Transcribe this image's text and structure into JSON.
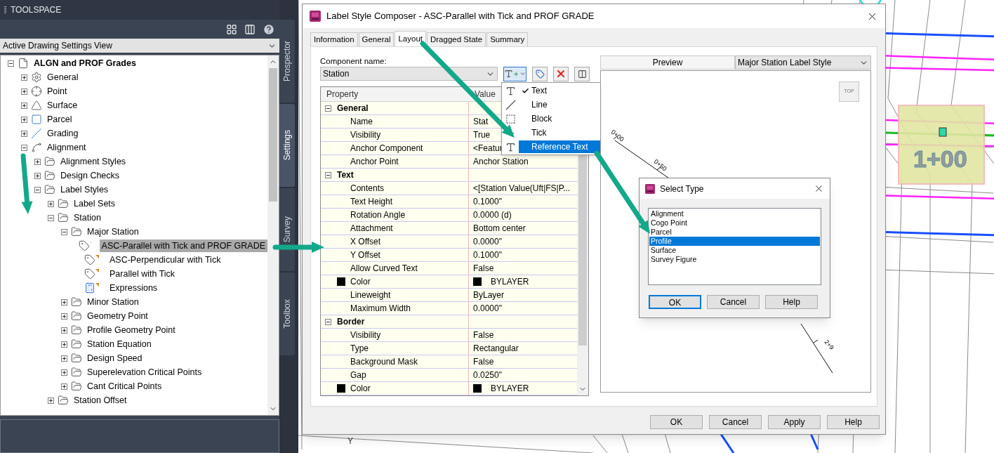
{
  "toolspace": {
    "title": "TOOLSPACE",
    "view": "Active Drawing Settings View",
    "tree": [
      {
        "label": "ALGN and PROF Grades",
        "kind": "drawing",
        "expanded": true,
        "selected": false,
        "children": [
          {
            "label": "General",
            "kind": "general",
            "expanded": false,
            "selected": false
          },
          {
            "label": "Point",
            "kind": "point",
            "expanded": false,
            "selected": false
          },
          {
            "label": "Surface",
            "kind": "surface",
            "expanded": false,
            "selected": false
          },
          {
            "label": "Parcel",
            "kind": "parcel",
            "expanded": false,
            "selected": false
          },
          {
            "label": "Grading",
            "kind": "grading",
            "expanded": false,
            "selected": false
          },
          {
            "label": "Alignment",
            "kind": "alignment",
            "expanded": true,
            "selected": false,
            "children": [
              {
                "label": "Alignment Styles",
                "kind": "folder",
                "expanded": false,
                "selected": false
              },
              {
                "label": "Design Checks",
                "kind": "folder",
                "expanded": false,
                "selected": false
              },
              {
                "label": "Label Styles",
                "kind": "folder",
                "expanded": true,
                "selected": false,
                "children": [
                  {
                    "label": "Label Sets",
                    "kind": "folder",
                    "expanded": false,
                    "selected": false
                  },
                  {
                    "label": "Station",
                    "kind": "folder",
                    "expanded": true,
                    "selected": false,
                    "children": [
                      {
                        "label": "Major Station",
                        "kind": "folder",
                        "expanded": true,
                        "selected": false,
                        "children": [
                          {
                            "label": "ASC-Parallel with Tick and PROF GRADE",
                            "kind": "style",
                            "selected": true
                          },
                          {
                            "label": "ASC-Perpendicular with Tick",
                            "kind": "style",
                            "selected": false
                          },
                          {
                            "label": "Parallel with Tick",
                            "kind": "style",
                            "selected": false
                          },
                          {
                            "label": "Expressions",
                            "kind": "expressions",
                            "selected": false
                          }
                        ]
                      },
                      {
                        "label": "Minor Station",
                        "kind": "folder",
                        "expanded": false,
                        "selected": false
                      },
                      {
                        "label": "Geometry Point",
                        "kind": "folder",
                        "expanded": false,
                        "selected": false
                      },
                      {
                        "label": "Profile Geometry Point",
                        "kind": "folder",
                        "expanded": false,
                        "selected": false
                      },
                      {
                        "label": "Station Equation",
                        "kind": "folder",
                        "expanded": false,
                        "selected": false
                      },
                      {
                        "label": "Design Speed",
                        "kind": "folder",
                        "expanded": false,
                        "selected": false
                      },
                      {
                        "label": "Superelevation Critical Points",
                        "kind": "folder",
                        "expanded": false,
                        "selected": false
                      },
                      {
                        "label": "Cant Critical Points",
                        "kind": "folder",
                        "expanded": false,
                        "selected": false
                      }
                    ]
                  },
                  {
                    "label": "Station Offset",
                    "kind": "folder",
                    "expanded": false,
                    "selected": false
                  }
                ]
              }
            ]
          }
        ]
      }
    ]
  },
  "side_tabs": [
    {
      "label": "Prospector",
      "selected": false
    },
    {
      "label": "Settings",
      "selected": true
    },
    {
      "label": "Survey",
      "selected": false
    },
    {
      "label": "Toolbox",
      "selected": false
    }
  ],
  "drawing": {
    "labels": [
      "1+00",
      "Y"
    ]
  },
  "dialog": {
    "title": "Label Style Composer - ASC-Parallel with Tick and PROF GRADE",
    "tabs": [
      {
        "label": "Information",
        "selected": false
      },
      {
        "label": "General",
        "selected": false
      },
      {
        "label": "Layout",
        "selected": true
      },
      {
        "label": "Dragged State",
        "selected": false
      },
      {
        "label": "Summary",
        "selected": false
      }
    ],
    "component_label": "Component name:",
    "component_value": "Station",
    "add_menu": [
      {
        "label": "Text",
        "kind": "text",
        "checked": true,
        "selected": false
      },
      {
        "label": "Line",
        "kind": "line",
        "checked": false,
        "selected": false
      },
      {
        "label": "Block",
        "kind": "block",
        "checked": false,
        "selected": false
      },
      {
        "label": "Tick",
        "kind": "tick",
        "checked": false,
        "selected": false
      },
      {
        "label": "Reference Text",
        "kind": "reference",
        "checked": false,
        "selected": true
      }
    ],
    "grid": {
      "columns": [
        "Property",
        "Value"
      ],
      "sections": [
        {
          "name": "General",
          "expanded": true,
          "rows": [
            {
              "property": "Name",
              "value": "Stat",
              "kind": "text"
            },
            {
              "property": "Visibility",
              "value": "True",
              "kind": "text"
            },
            {
              "property": "Anchor Component",
              "value": "<Featur",
              "kind": "text"
            },
            {
              "property": "Anchor Point",
              "value": "Anchor Station",
              "kind": "text"
            }
          ]
        },
        {
          "name": "Text",
          "expanded": true,
          "rows": [
            {
              "property": "Contents",
              "value": "<[Station Value(Uft|FS|P...",
              "kind": "text"
            },
            {
              "property": "Text Height",
              "value": "0.1000\"",
              "kind": "text"
            },
            {
              "property": "Rotation Angle",
              "value": "0.0000 (d)",
              "kind": "text"
            },
            {
              "property": "Attachment",
              "value": "Bottom center",
              "kind": "text"
            },
            {
              "property": "X Offset",
              "value": "0.0000\"",
              "kind": "text"
            },
            {
              "property": "Y Offset",
              "value": "0.1000\"",
              "kind": "text"
            },
            {
              "property": "Allow Curved Text",
              "value": "False",
              "kind": "text"
            },
            {
              "property": "Color",
              "value": "BYLAYER",
              "kind": "color",
              "color": "#000000"
            },
            {
              "property": "Lineweight",
              "value": "ByLayer",
              "kind": "text"
            },
            {
              "property": "Maximum Width",
              "value": "0.0000\"",
              "kind": "text"
            }
          ]
        },
        {
          "name": "Border",
          "expanded": true,
          "rows": [
            {
              "property": "Visibility",
              "value": "False",
              "kind": "text"
            },
            {
              "property": "Type",
              "value": "Rectangular",
              "kind": "text"
            },
            {
              "property": "Background Mask",
              "value": "False",
              "kind": "text"
            },
            {
              "property": "Gap",
              "value": "0.0250\"",
              "kind": "text"
            },
            {
              "property": "Color",
              "value": "BYLAYER",
              "kind": "color",
              "color": "#000000"
            }
          ]
        }
      ]
    },
    "preview": {
      "label": "Preview",
      "style": "Major Station Label Style",
      "view_button": "TOP",
      "labels": [
        "0+00",
        "0+50",
        "2+9"
      ]
    },
    "buttons": [
      "OK",
      "Cancel",
      "Apply",
      "Help"
    ]
  },
  "select_type": {
    "title": "Select Type",
    "items": [
      {
        "label": "Alignment",
        "selected": false
      },
      {
        "label": "Cogo Point",
        "selected": false
      },
      {
        "label": "Parcel",
        "selected": false
      },
      {
        "label": "Profile",
        "selected": true
      },
      {
        "label": "Surface",
        "selected": false
      },
      {
        "label": "Survey Figure",
        "selected": false
      }
    ],
    "buttons": [
      {
        "label": "OK",
        "default": true
      },
      {
        "label": "Cancel",
        "default": false
      },
      {
        "label": "Help",
        "default": false
      }
    ]
  }
}
